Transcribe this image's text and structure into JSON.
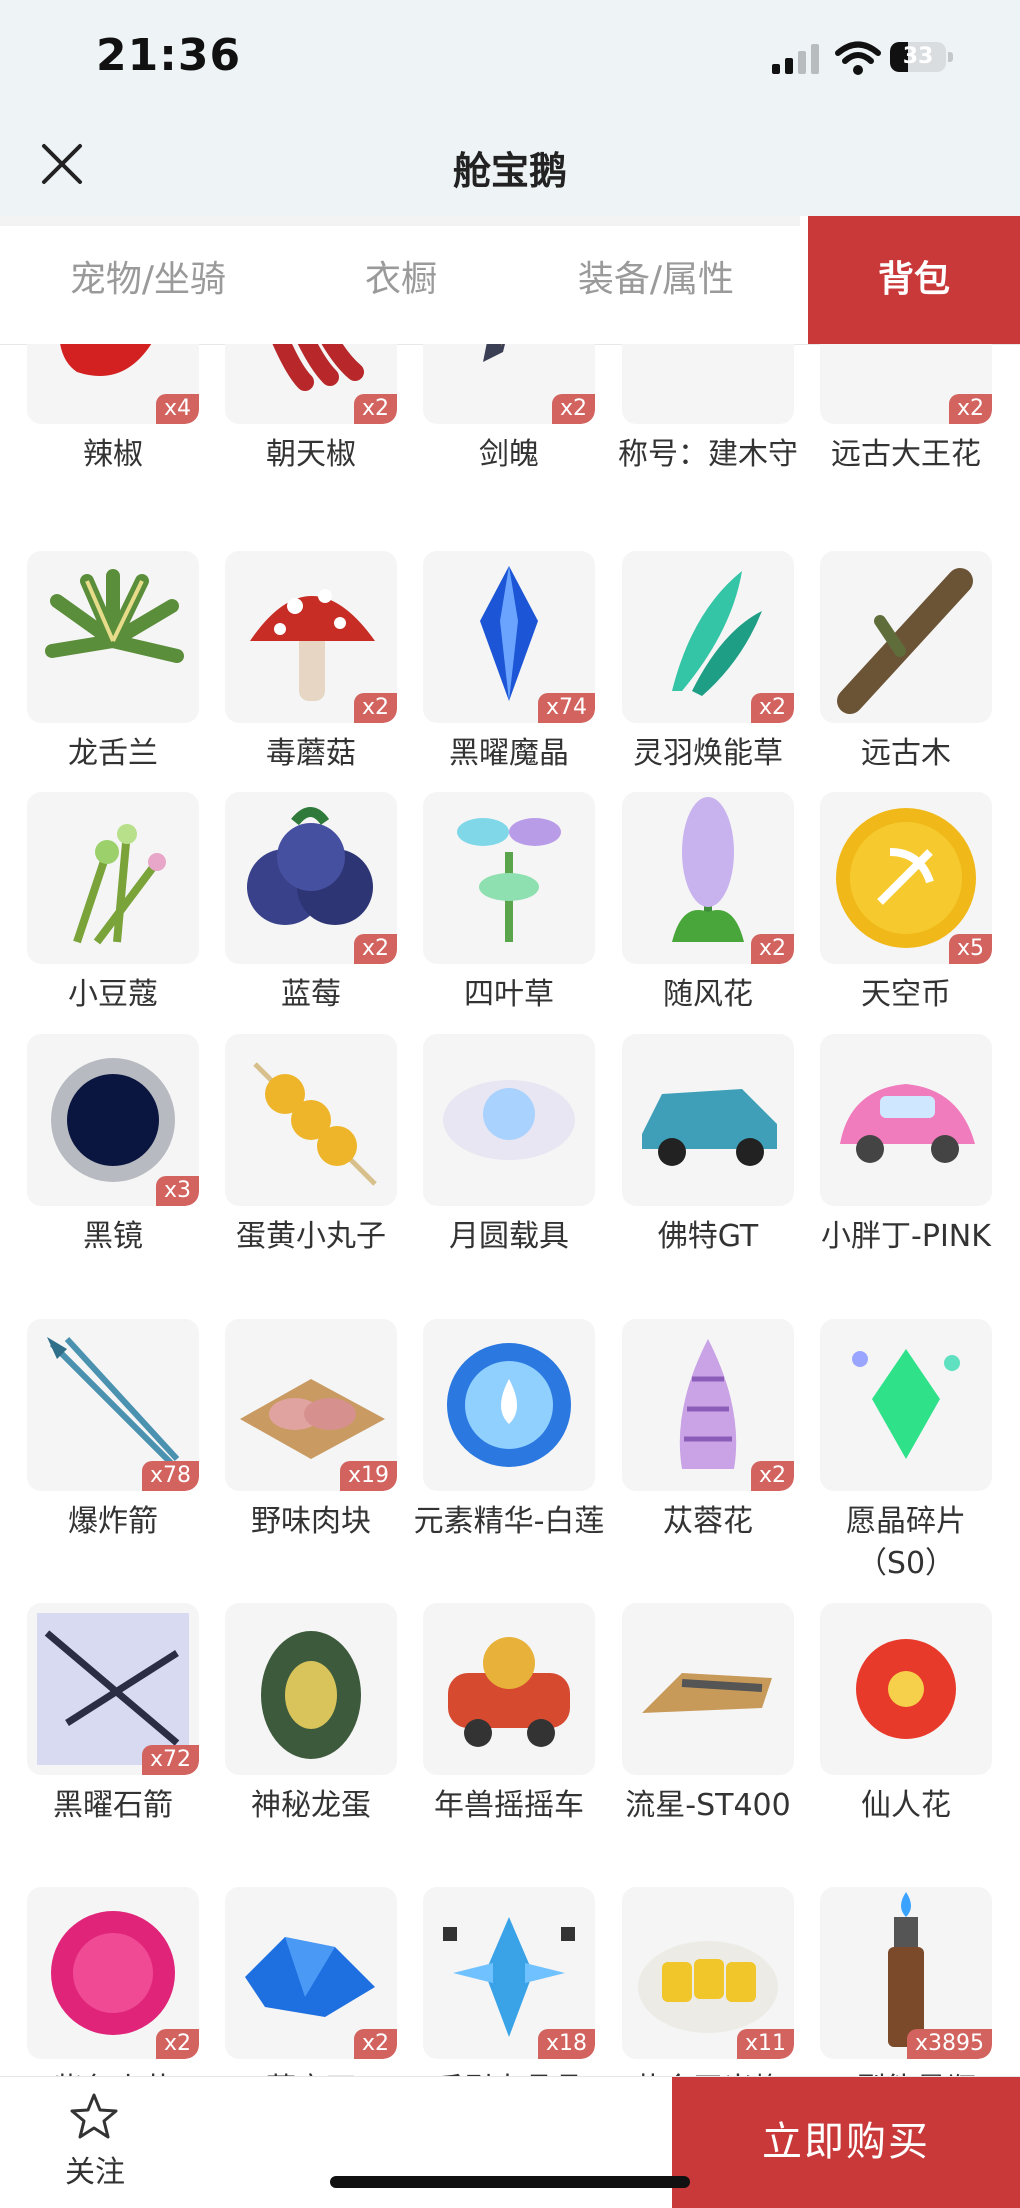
{
  "status": {
    "time": "21:36",
    "battery": "33",
    "battery_level": 0.33
  },
  "header": {
    "title": "舱宝鹅",
    "close_icon": "close-icon"
  },
  "tabs": [
    {
      "label": "宠物/坐骑",
      "active": false
    },
    {
      "label": "衣橱",
      "active": false
    },
    {
      "label": "装备/属性",
      "active": false
    },
    {
      "label": "背包",
      "active": true
    }
  ],
  "colors": {
    "accent": "#c9393a",
    "badge": "#d2635f",
    "background": "#eef3f6"
  },
  "items": [
    {
      "name": "辣椒",
      "count": "x4",
      "icon": "chili-pepper-icon"
    },
    {
      "name": "朝天椒",
      "count": "x2",
      "icon": "red-peppers-icon"
    },
    {
      "name": "剑魄",
      "count": "x2",
      "icon": "sword-soul-icon"
    },
    {
      "name": "称号：建木守",
      "count": "",
      "icon": "title-badge-icon"
    },
    {
      "name": "远古大王花",
      "count": "x2",
      "icon": "ancient-flower-icon"
    },
    {
      "name": "龙舌兰",
      "count": "",
      "icon": "agave-icon"
    },
    {
      "name": "毒蘑菇",
      "count": "x2",
      "icon": "poison-mushroom-icon"
    },
    {
      "name": "黑曜魔晶",
      "count": "x74",
      "icon": "blue-crystal-icon"
    },
    {
      "name": "灵羽焕能草",
      "count": "x2",
      "icon": "feather-grass-icon"
    },
    {
      "name": "远古木",
      "count": "",
      "icon": "ancient-wood-icon"
    },
    {
      "name": "小豆蔻",
      "count": "",
      "icon": "cardamom-icon"
    },
    {
      "name": "蓝莓",
      "count": "x2",
      "icon": "blueberry-icon"
    },
    {
      "name": "四叶草",
      "count": "",
      "icon": "clover-icon"
    },
    {
      "name": "随风花",
      "count": "x2",
      "icon": "hyacinth-icon"
    },
    {
      "name": "天空币",
      "count": "x5",
      "icon": "sky-coin-icon"
    },
    {
      "name": "黑镜",
      "count": "x3",
      "icon": "black-mirror-icon"
    },
    {
      "name": "蛋黄小丸子",
      "count": "",
      "icon": "yolk-skewer-icon"
    },
    {
      "name": "月圆载具",
      "count": "",
      "icon": "moon-vehicle-icon"
    },
    {
      "name": "佛特GT",
      "count": "",
      "icon": "blue-car-icon"
    },
    {
      "name": "小胖丁-PINK",
      "count": "",
      "icon": "pink-car-icon"
    },
    {
      "name": "爆炸箭",
      "count": "x78",
      "icon": "explosive-arrow-icon"
    },
    {
      "name": "野味肉块",
      "count": "x19",
      "icon": "meat-block-icon"
    },
    {
      "name": "元素精华-白莲",
      "count": "",
      "icon": "lotus-orb-icon"
    },
    {
      "name": "苁蓉花",
      "count": "x2",
      "icon": "cistanche-flower-icon"
    },
    {
      "name": "愿晶碎片（S0）",
      "count": "",
      "icon": "wish-crystal-icon"
    },
    {
      "name": "黑曜石箭",
      "count": "x72",
      "icon": "obsidian-arrow-icon"
    },
    {
      "name": "神秘龙蛋",
      "count": "",
      "icon": "dragon-egg-icon"
    },
    {
      "name": "年兽摇摇车",
      "count": "",
      "icon": "nian-beast-cart-icon"
    },
    {
      "name": "流星-ST400",
      "count": "",
      "icon": "meteor-bike-icon"
    },
    {
      "name": "仙人花",
      "count": "",
      "icon": "cactus-flower-icon"
    },
    {
      "name": "紫色小花",
      "count": "x2",
      "icon": "pink-flower-icon"
    },
    {
      "name": "蓝宝石",
      "count": "x2",
      "icon": "sapphire-icon"
    },
    {
      "name": "反引力晶晶",
      "count": "x18",
      "icon": "antigravity-crystal-icon"
    },
    {
      "name": "黄金玉米烙",
      "count": "x11",
      "icon": "golden-corn-plate-icon"
    },
    {
      "name": "A型能量瓶",
      "count": "x3895",
      "icon": "energy-bottle-icon"
    }
  ],
  "footer": {
    "follow_label": "关注",
    "buy_label": "立即购买"
  }
}
